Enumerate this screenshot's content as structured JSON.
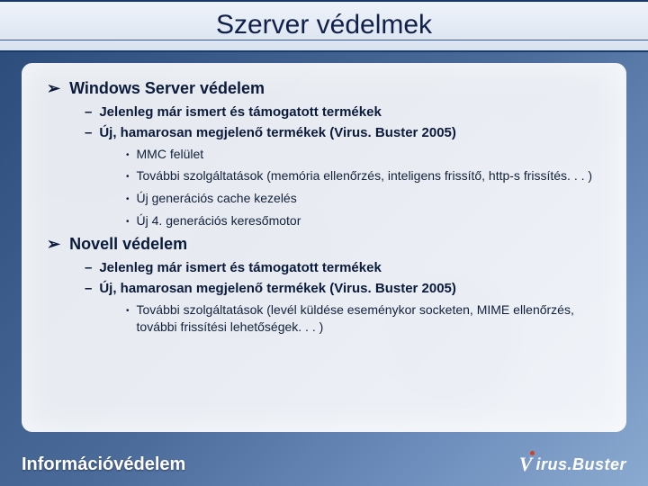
{
  "title": "Szerver védelmek",
  "footer": "Információvédelem",
  "logo": {
    "v": "V",
    "rest": "irus.Buster"
  },
  "s1": {
    "h": "Windows Server védelem",
    "a": "Jelenleg már ismert és támogatott termékek",
    "b": "Új, hamarosan megjelenő termékek (Virus. Buster 2005)",
    "b1": "MMC felület",
    "b2": "További szolgáltatások (memória ellenőrzés, inteligens frissítő, http-s frissítés. . . )",
    "b3": "Új generációs cache kezelés",
    "b4": "Új 4. generációs keresőmotor"
  },
  "s2": {
    "h": "Novell védelem",
    "a": "Jelenleg már ismert és támogatott termékek",
    "b": "Új, hamarosan megjelenő termékek (Virus. Buster 2005)",
    "b1": "További szolgáltatások (levél küldése eseménykor socketen, MIME ellenőrzés, további frissítési lehetőségek. . . )"
  }
}
